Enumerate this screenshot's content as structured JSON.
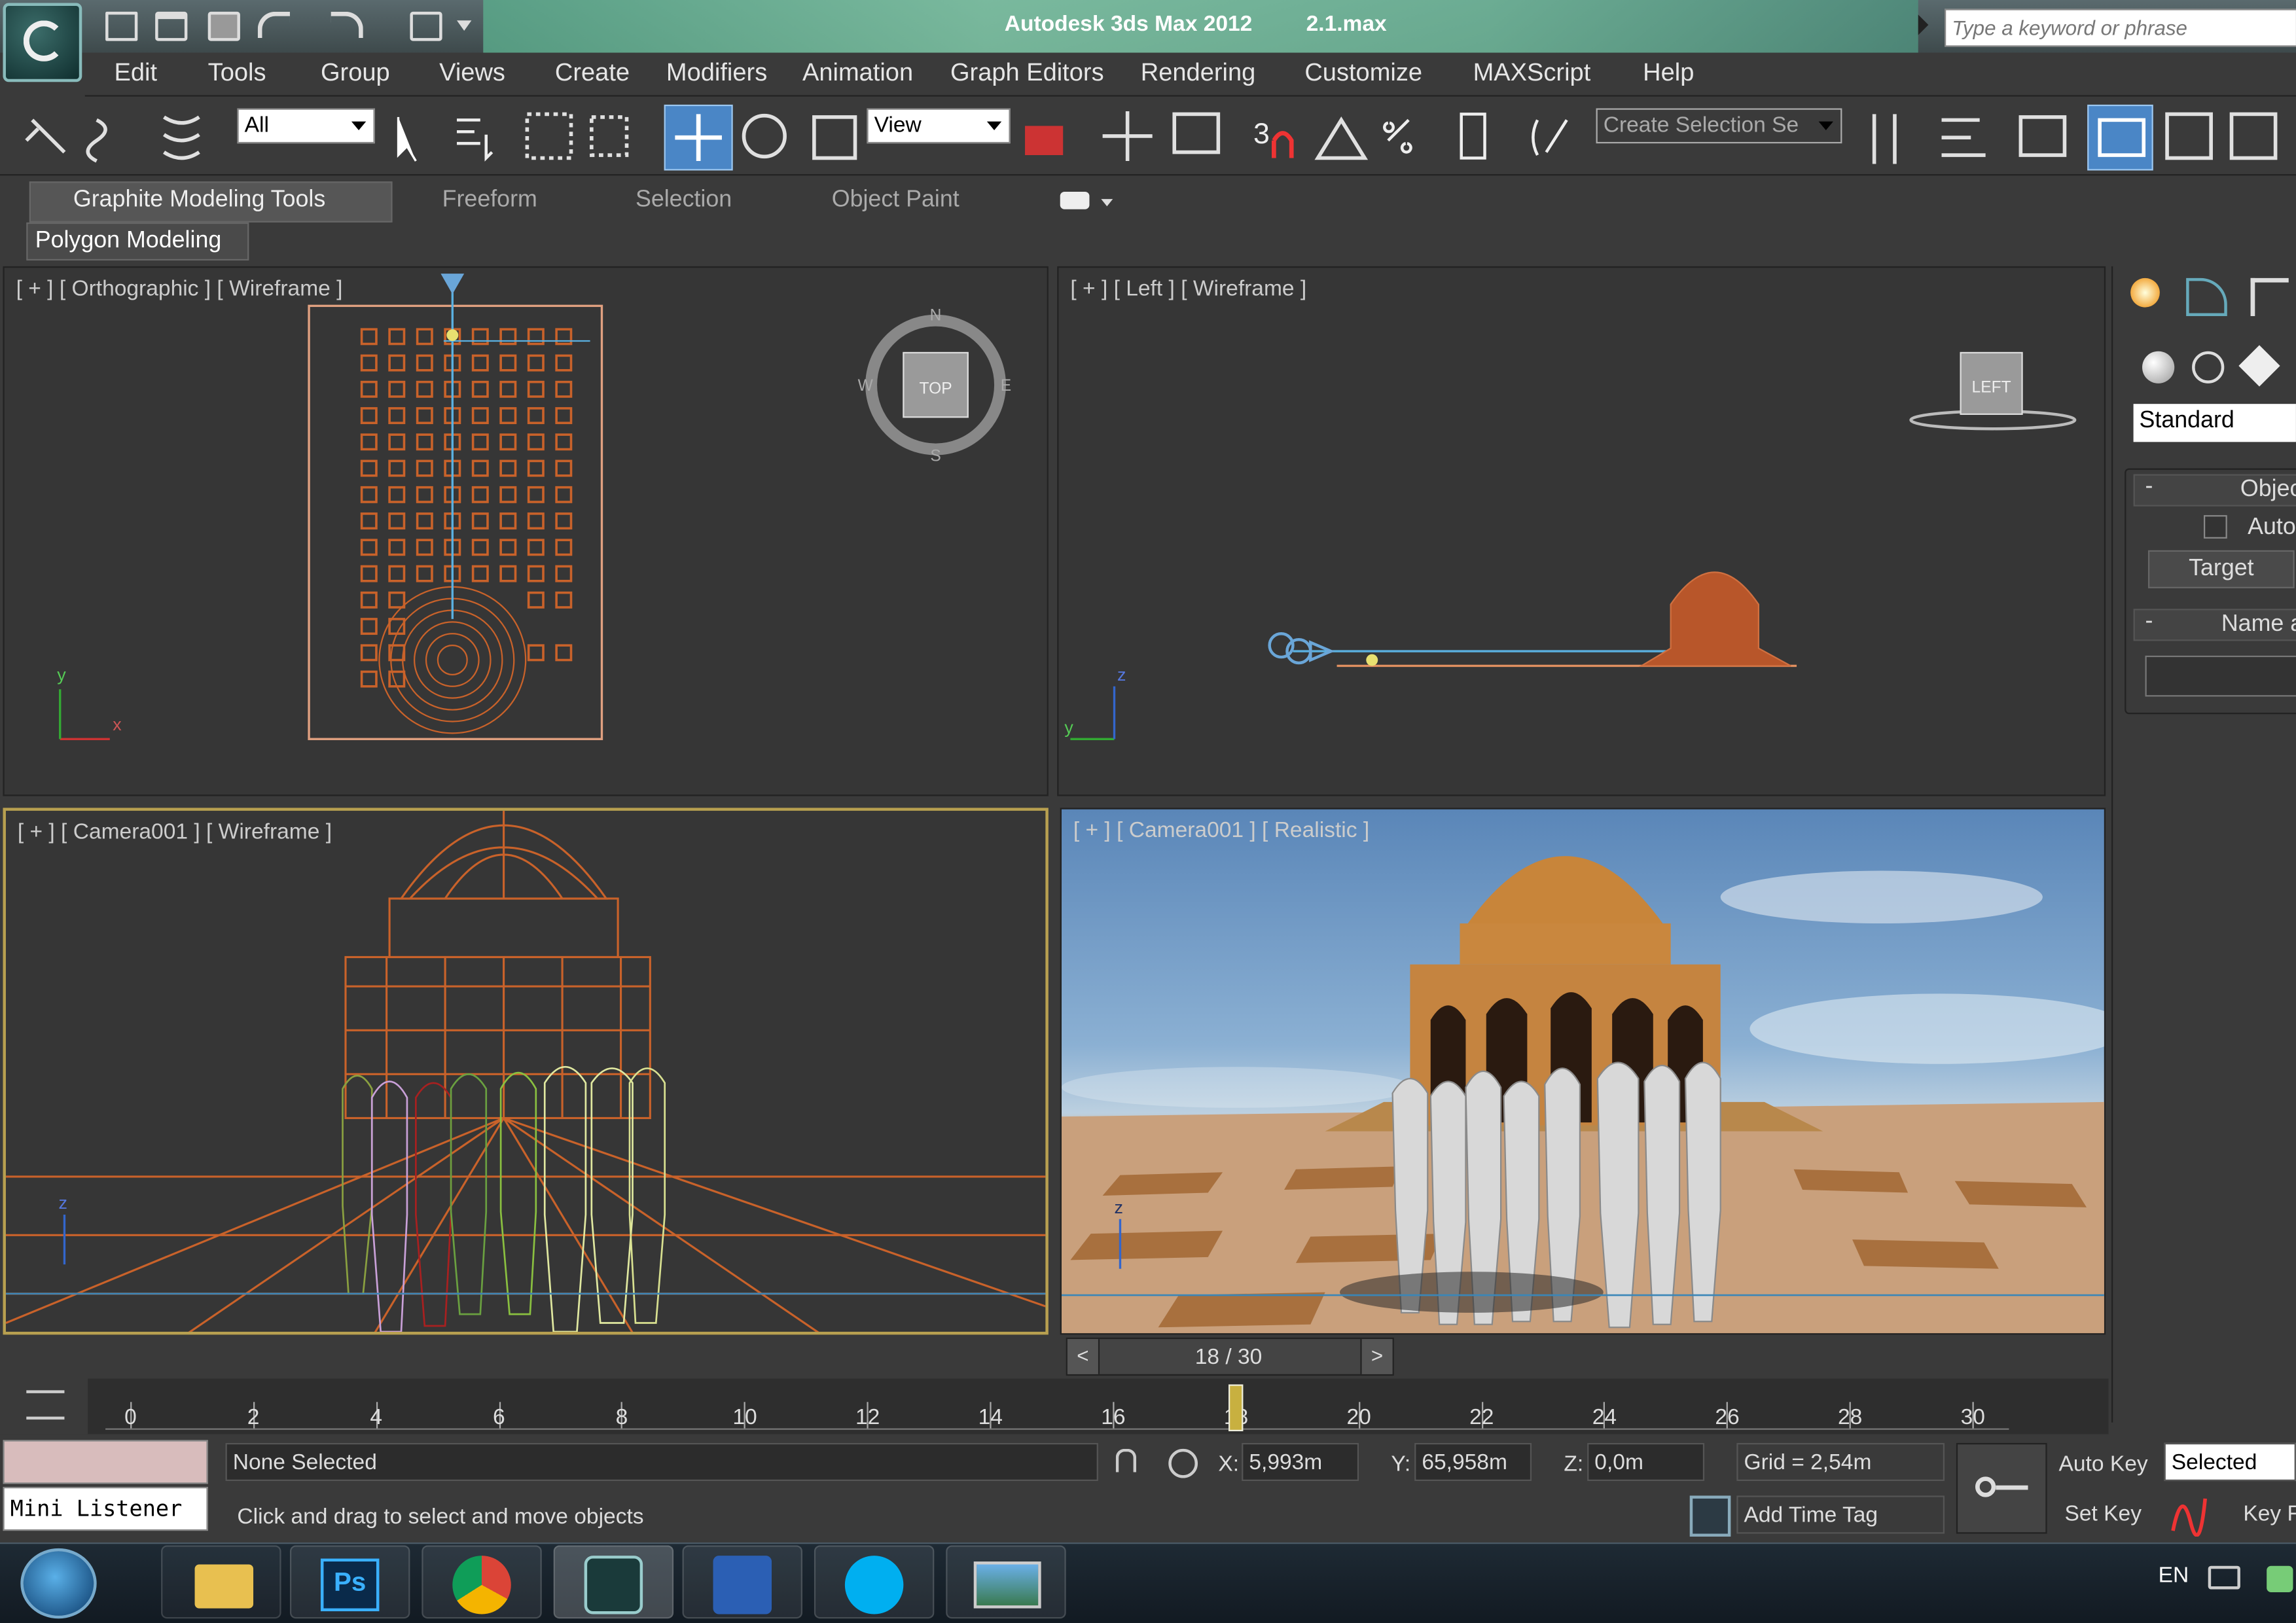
{
  "window": {
    "app_title": "Autodesk 3ds Max 2012",
    "file_name": "2.1.max",
    "search_placeholder": "Type a keyword or phrase"
  },
  "menu": [
    "Edit",
    "Tools",
    "Group",
    "Views",
    "Create",
    "Modifiers",
    "Animation",
    "Graph Editors",
    "Rendering",
    "Customize",
    "MAXScript",
    "Help"
  ],
  "toolbar": {
    "selection_filter": "All",
    "reference_coord": "View",
    "named_selection": "Create Selection Se",
    "snap_label": "3"
  },
  "ribbon": {
    "tabs": [
      "Graphite Modeling Tools",
      "Freeform",
      "Selection",
      "Object Paint"
    ],
    "panel": "Polygon Modeling"
  },
  "viewports": {
    "top_left": "[ + ] [ Orthographic ] [ Wireframe ]",
    "top_right": "[ + ] [ Left ] [ Wireframe ]",
    "bottom_left": "[ + ] [ Camera001 ] [ Wireframe ]",
    "bottom_right": "[ + ] [ Camera001 ] [ Realistic ]",
    "viewcube_top": "TOP",
    "viewcube_left": "LEFT",
    "compass": {
      "n": "N",
      "s": "S",
      "e": "E",
      "w": "W"
    },
    "axes": {
      "x": "x",
      "y": "y",
      "z": "z"
    }
  },
  "command_panel": {
    "dropdown": "Standard",
    "rollout_object_type": "Objec",
    "autogrid": "Auto",
    "target_button": "Target",
    "rollout_name": "Name a"
  },
  "timeline": {
    "frame_label": "18 / 30",
    "prev": "<",
    "next": ">",
    "ticks": [
      "0",
      "2",
      "4",
      "6",
      "8",
      "10",
      "12",
      "14",
      "16",
      "18",
      "20",
      "22",
      "24",
      "26",
      "28",
      "30"
    ],
    "current_frame": 18,
    "total_frames": 30
  },
  "status": {
    "listener": "Mini Listener",
    "selection": "None Selected",
    "prompt": "Click and drag to select and move objects",
    "x_label": "X:",
    "x_value": "5,993m",
    "y_label": "Y:",
    "y_value": "65,958m",
    "z_label": "Z:",
    "z_value": "0,0m",
    "grid": "Grid = 2,54m",
    "add_time_tag": "Add Time Tag",
    "auto_key": "Auto Key",
    "key_mode": "Selected",
    "set_key": "Set Key",
    "key_filters": "Key F"
  },
  "taskbar": {
    "language": "EN",
    "apps": [
      "explorer",
      "photoshop",
      "chrome",
      "3dsmax",
      "word",
      "skype",
      "photo-viewer"
    ],
    "ps_label": "Ps"
  },
  "colors": {
    "accent": "#5aa88a",
    "wire_orange": "#c9622a",
    "active_border": "#b8a050"
  }
}
